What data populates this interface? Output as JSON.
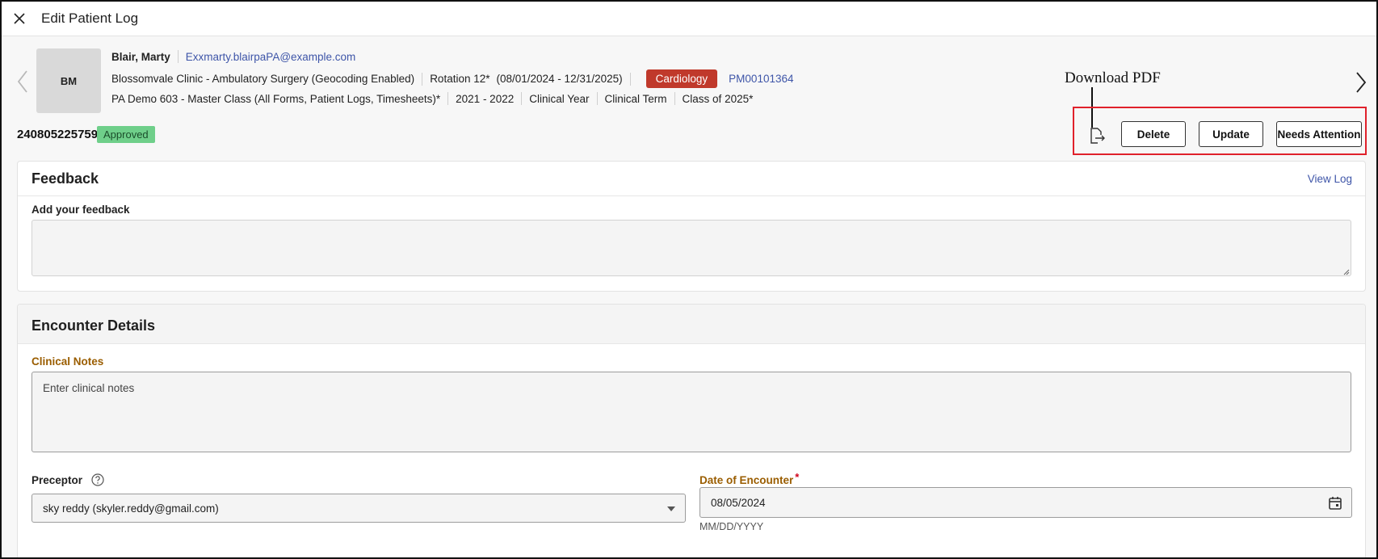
{
  "window": {
    "title": "Edit Patient Log"
  },
  "student": {
    "initials": "BM",
    "name": "Blair, Marty",
    "email": "Exxmarty.blairpaPA@example.com",
    "site": "Blossomvale Clinic - Ambulatory Surgery (Geocoding Enabled)",
    "rotation": "Rotation 12*",
    "date_range": "(08/01/2024 - 12/31/2025)",
    "specialty": "Cardiology",
    "record_id": "PM00101364",
    "program": "PA Demo 603 - Master Class (All Forms, Patient Logs, Timesheets)*",
    "academic_year": "2021 - 2022",
    "clinical_year": "Clinical Year",
    "clinical_term": "Clinical Term",
    "class": "Class of 2025*"
  },
  "log": {
    "id": "240805225759",
    "status": "Approved"
  },
  "annotation": {
    "label": "Download PDF"
  },
  "actions": {
    "delete": "Delete",
    "update": "Update",
    "needs_attention": "Needs Attention"
  },
  "feedback": {
    "title": "Feedback",
    "view_log": "View Log",
    "field_label": "Add your feedback",
    "value": ""
  },
  "encounter": {
    "title": "Encounter Details",
    "clinical_notes_label": "Clinical Notes",
    "clinical_notes_placeholder": "Enter clinical notes",
    "preceptor_label": "Preceptor",
    "preceptor_value": "sky reddy (skyler.reddy@gmail.com)",
    "date_label": "Date of Encounter",
    "required_mark": "*",
    "date_value": "08/05/2024",
    "date_hint": "MM/DD/YYYY"
  },
  "colors": {
    "specialty_badge": "#c0392b",
    "status_badge": "#6fcf8a",
    "link": "#3e55a8",
    "highlight": "#e0212b",
    "field_label_accent": "#9a5d00"
  },
  "icons": [
    "close-icon",
    "chevron-left-icon",
    "chevron-right-icon",
    "file-export-icon",
    "help-circle-icon",
    "caret-down-icon",
    "calendar-icon",
    "resize-grip-icon"
  ]
}
